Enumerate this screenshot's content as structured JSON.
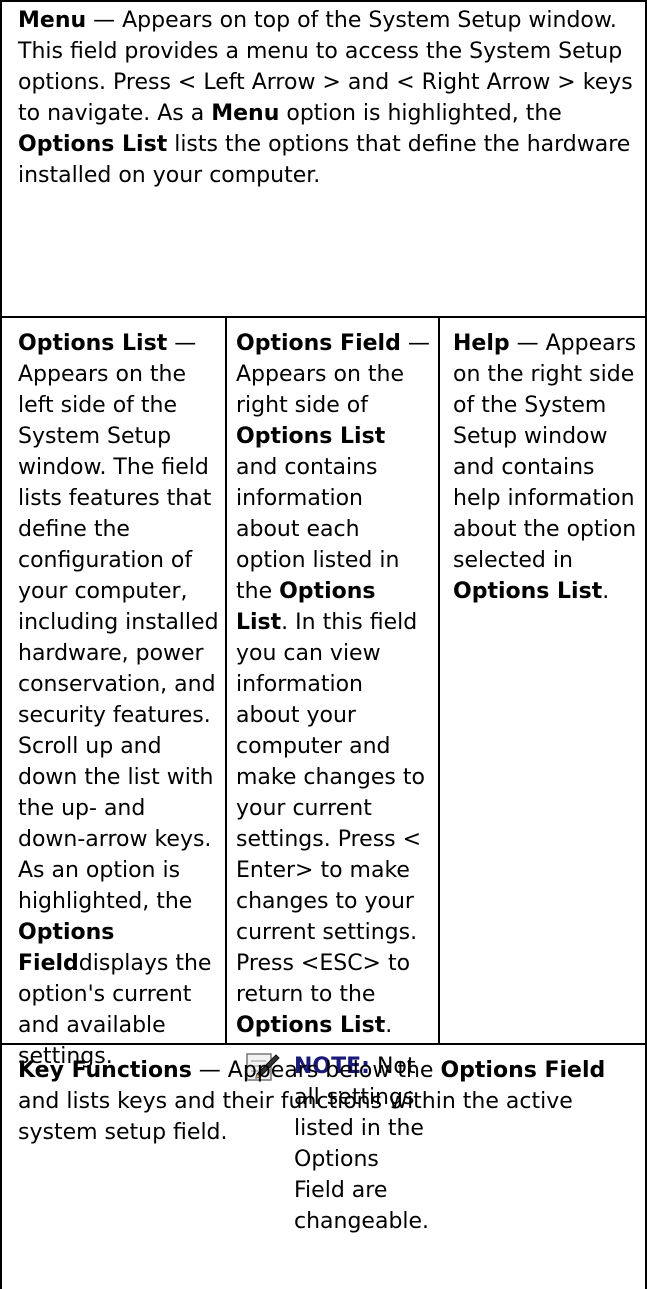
{
  "menu": {
    "term": "Menu",
    "desc_1": " — Appears on top of the System Setup window. This field provides a menu to access the System Setup options. Press < Left Arrow > and < Right Arrow > keys to navigate. As a ",
    "inline_term": "Menu",
    "desc_2": " option is highlighted, the ",
    "inline_term_2": "Options List",
    "desc_3": " lists the options that define the hardware installed on your computer."
  },
  "options_list": {
    "term": "Options List",
    "desc_1": " — Appears on the left side of the System Setup window. The field lists features that define the configuration of your computer, including installed hardware, power conservation, and security features. Scroll up and down the list with the up- and down-arrow keys. As an option is highlighted, the ",
    "inline_term": "Options Field",
    "desc_2": "displays the option's current and available settings."
  },
  "options_field": {
    "term": "Options Field",
    "desc_1": " — Appears on the right side of ",
    "inline_term": "Options List",
    "desc_2": " and contains information about each option listed in the ",
    "inline_term_2": "Options List",
    "desc_3": ". In this field you can view information about your computer and make changes to your current settings. Press < Enter> to make changes to your current settings. Press <ESC> to return to the ",
    "inline_term_3": "Options List",
    "desc_4": ".",
    "note_label": "NOTE:",
    "note_text": " Not all settings listed in the Options Field are changeable."
  },
  "help": {
    "term": "Help",
    "desc_1": " — Appears on the right side of the System Setup window and contains help information about the option selected in ",
    "inline_term": "Options List",
    "desc_2": "."
  },
  "key_functions": {
    "term": "Key Functions",
    "desc_1": " — Appears below the ",
    "inline_term": "Options Field",
    "desc_2": " and lists keys and their functions within the active system setup field."
  },
  "icons": {
    "note": "pencil-note-icon"
  }
}
